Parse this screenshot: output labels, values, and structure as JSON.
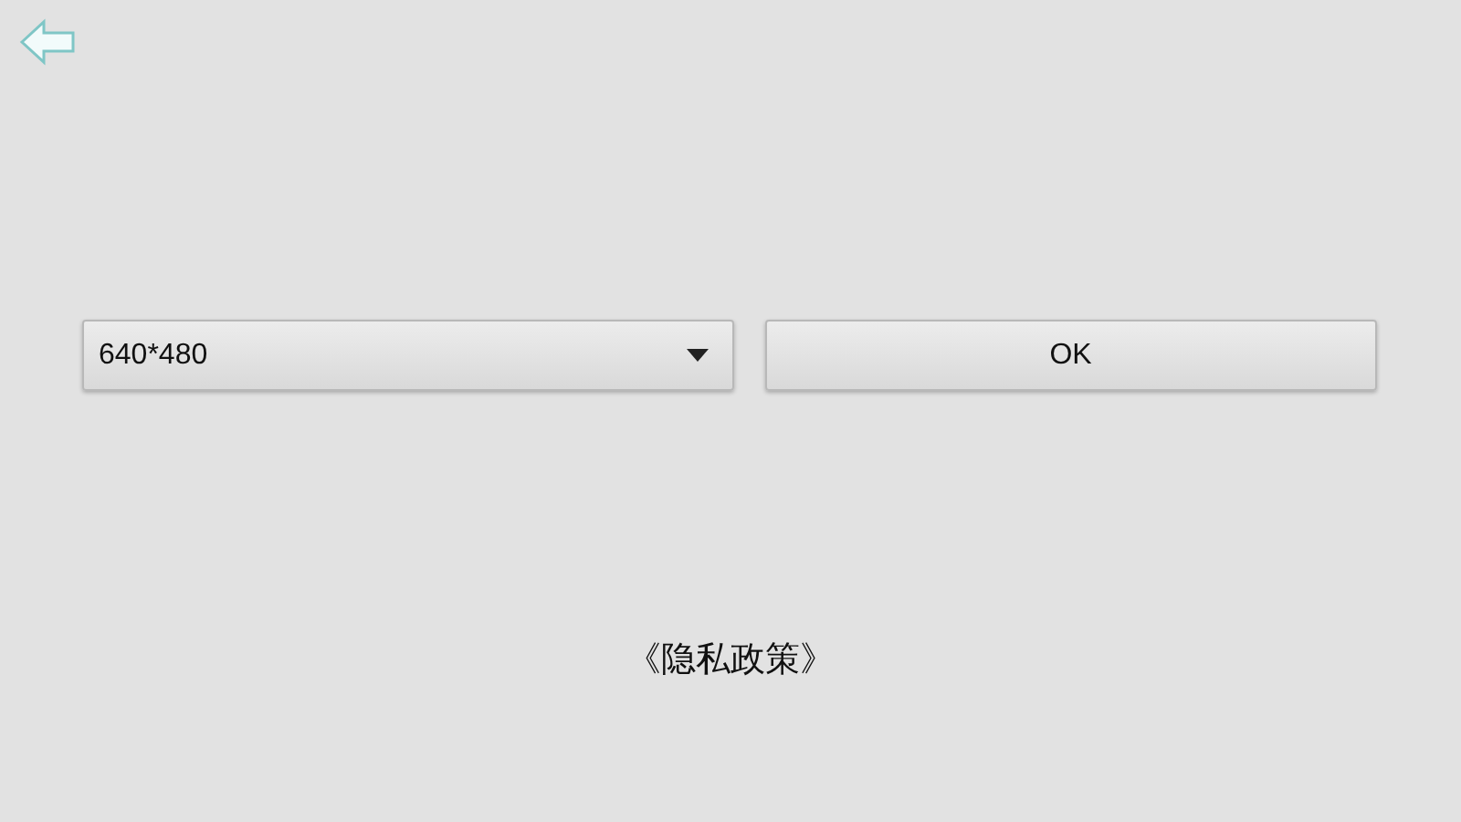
{
  "resolution_select": {
    "value": "640*480"
  },
  "ok_button": {
    "label": "OK"
  },
  "privacy_link": {
    "label": "《隐私政策》"
  }
}
